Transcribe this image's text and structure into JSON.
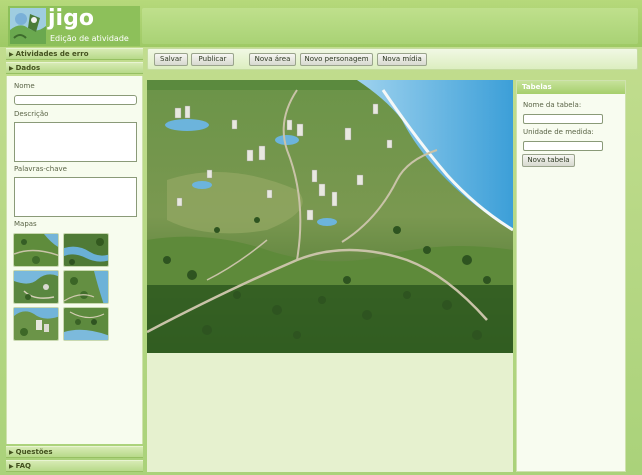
{
  "app": {
    "logo_name": "jigo",
    "logo_subtitle": "Edição de atividade"
  },
  "sidebar": {
    "sections": [
      {
        "label": "Atividades de erro"
      },
      {
        "label": "Dados"
      },
      {
        "label": "Questões"
      },
      {
        "label": "FAQ"
      }
    ],
    "fields": {
      "name_label": "Nome",
      "name_value": "",
      "description_label": "Descrição",
      "description_value": "",
      "keywords_label": "Palavras-chave",
      "keywords_value": "",
      "maps_label": "Mapas"
    }
  },
  "toolbar": {
    "save": "Salvar",
    "publish": "Publicar",
    "new_area": "Nova área",
    "new_character": "Novo personagem",
    "new_media": "Nova mídia"
  },
  "tables_panel": {
    "title": "Tabelas",
    "table_name_label": "Nome da tabela:",
    "table_name_value": "",
    "unit_label": "Unidade de medida:",
    "unit_value": "",
    "new_table_button": "Nova tabela"
  },
  "colors": {
    "accent": "#a6cf6c",
    "header": "#9ec965",
    "panel_bg": "#f7fcee"
  }
}
